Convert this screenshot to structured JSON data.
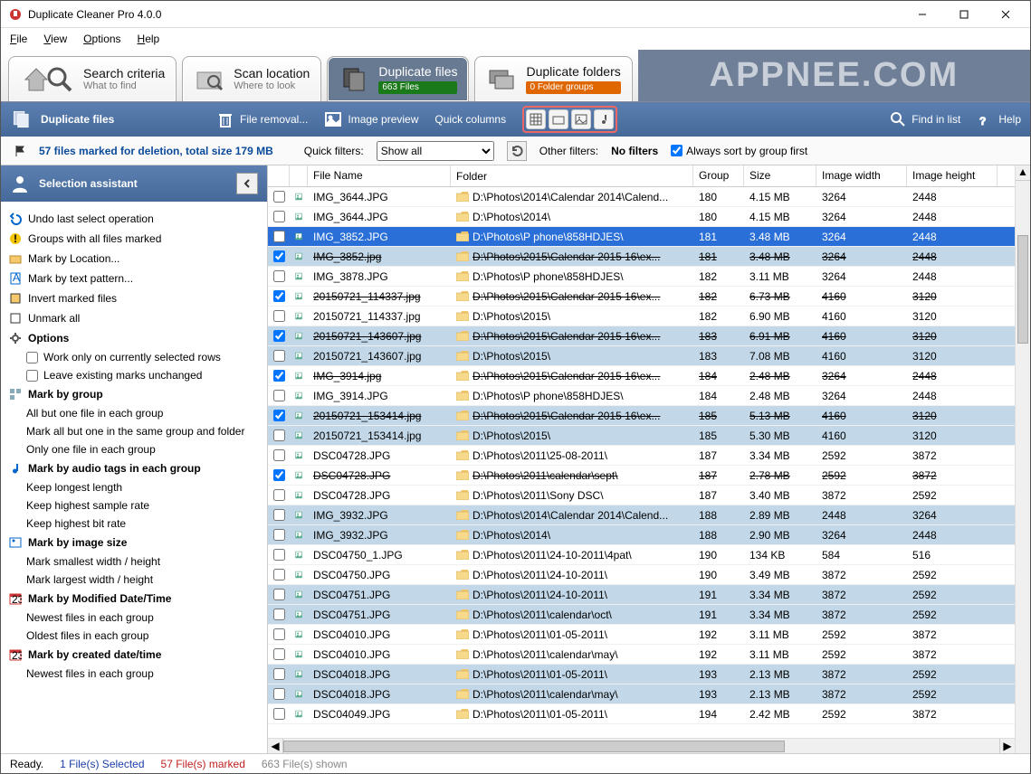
{
  "window": {
    "title": "Duplicate Cleaner Pro 4.0.0"
  },
  "menu": {
    "file": "File",
    "view": "View",
    "options": "Options",
    "help": "Help"
  },
  "tabs": {
    "search": {
      "title": "Search criteria",
      "sub": "What to find"
    },
    "scan": {
      "title": "Scan location",
      "sub": "Where to look"
    },
    "files": {
      "title": "Duplicate files",
      "badge": "663 Files"
    },
    "folders": {
      "title": "Duplicate folders",
      "badge": "0 Folder groups"
    }
  },
  "watermark": "APPNEE.COM",
  "bluebar": {
    "title": "Duplicate files",
    "removal": "File removal...",
    "preview": "Image preview",
    "quickcols": "Quick columns",
    "find": "Find in list",
    "help": "Help"
  },
  "filter": {
    "marked": "57 files marked for deletion, total size 179 MB",
    "quick_label": "Quick filters:",
    "showall": "Show all",
    "other_label": "Other filters:",
    "nofilters": "No filters",
    "sortfirst": "Always sort by group first"
  },
  "sidebar": {
    "title": "Selection assistant",
    "undo": "Undo last select operation",
    "groupsall": "Groups with all files marked",
    "byloc": "Mark by Location...",
    "bytext": "Mark by text pattern...",
    "invert": "Invert marked files",
    "unmark": "Unmark all",
    "options": "Options",
    "opt1": "Work only on currently selected rows",
    "opt2": "Leave existing marks unchanged",
    "bygroup": "Mark by group",
    "g1": "All but one file in each group",
    "g2": "Mark all but one in the same group and folder",
    "g3": "Only one file in each group",
    "byaudio": "Mark by audio tags in each group",
    "a1": "Keep longest length",
    "a2": "Keep highest sample rate",
    "a3": "Keep highest bit rate",
    "byimage": "Mark by image size",
    "i1": "Mark smallest width / height",
    "i2": "Mark largest width / height",
    "bymod": "Mark by Modified Date/Time",
    "m1": "Newest files in each group",
    "m2": "Oldest files in each group",
    "bycreated": "Mark by created date/time",
    "c1": "Newest files in each group"
  },
  "cols": {
    "name": "File Name",
    "folder": "Folder",
    "group": "Group",
    "size": "Size",
    "w": "Image width",
    "h": "Image height"
  },
  "rows": [
    {
      "chk": false,
      "strike": false,
      "sel": false,
      "blue": false,
      "name": "IMG_3644.JPG",
      "folder": "D:\\Photos\\2014\\Calendar 2014\\Calend...",
      "group": "180",
      "size": "4.15 MB",
      "w": "3264",
      "h": "2448"
    },
    {
      "chk": false,
      "strike": false,
      "sel": false,
      "blue": false,
      "name": "IMG_3644.JPG",
      "folder": "D:\\Photos\\2014\\",
      "group": "180",
      "size": "4.15 MB",
      "w": "3264",
      "h": "2448"
    },
    {
      "chk": false,
      "strike": false,
      "sel": true,
      "blue": true,
      "name": "IMG_3852.JPG",
      "folder": "D:\\Photos\\P phone\\858HDJES\\",
      "group": "181",
      "size": "3.48 MB",
      "w": "3264",
      "h": "2448"
    },
    {
      "chk": true,
      "strike": true,
      "sel": false,
      "blue": true,
      "name": "IMG_3852.jpg",
      "folder": "D:\\Photos\\2015\\Calendar 2015  16\\ex...",
      "group": "181",
      "size": "3.48 MB",
      "w": "3264",
      "h": "2448"
    },
    {
      "chk": false,
      "strike": false,
      "sel": false,
      "blue": false,
      "name": "IMG_3878.JPG",
      "folder": "D:\\Photos\\P phone\\858HDJES\\",
      "group": "182",
      "size": "3.11 MB",
      "w": "3264",
      "h": "2448"
    },
    {
      "chk": true,
      "strike": true,
      "sel": false,
      "blue": false,
      "name": "20150721_114337.jpg",
      "folder": "D:\\Photos\\2015\\Calendar 2015  16\\ex...",
      "group": "182",
      "size": "6.73 MB",
      "w": "4160",
      "h": "3120"
    },
    {
      "chk": false,
      "strike": false,
      "sel": false,
      "blue": false,
      "name": "20150721_114337.jpg",
      "folder": "D:\\Photos\\2015\\",
      "group": "182",
      "size": "6.90 MB",
      "w": "4160",
      "h": "3120"
    },
    {
      "chk": true,
      "strike": true,
      "sel": false,
      "blue": true,
      "name": "20150721_143607.jpg",
      "folder": "D:\\Photos\\2015\\Calendar 2015  16\\ex...",
      "group": "183",
      "size": "6.91 MB",
      "w": "4160",
      "h": "3120"
    },
    {
      "chk": false,
      "strike": false,
      "sel": false,
      "blue": true,
      "name": "20150721_143607.jpg",
      "folder": "D:\\Photos\\2015\\",
      "group": "183",
      "size": "7.08 MB",
      "w": "4160",
      "h": "3120"
    },
    {
      "chk": true,
      "strike": true,
      "sel": false,
      "blue": false,
      "name": "IMG_3914.jpg",
      "folder": "D:\\Photos\\2015\\Calendar 2015  16\\ex...",
      "group": "184",
      "size": "2.48 MB",
      "w": "3264",
      "h": "2448"
    },
    {
      "chk": false,
      "strike": false,
      "sel": false,
      "blue": false,
      "name": "IMG_3914.JPG",
      "folder": "D:\\Photos\\P phone\\858HDJES\\",
      "group": "184",
      "size": "2.48 MB",
      "w": "3264",
      "h": "2448"
    },
    {
      "chk": true,
      "strike": true,
      "sel": false,
      "blue": true,
      "name": "20150721_153414.jpg",
      "folder": "D:\\Photos\\2015\\Calendar 2015  16\\ex...",
      "group": "185",
      "size": "5.13 MB",
      "w": "4160",
      "h": "3120"
    },
    {
      "chk": false,
      "strike": false,
      "sel": false,
      "blue": true,
      "name": "20150721_153414.jpg",
      "folder": "D:\\Photos\\2015\\",
      "group": "185",
      "size": "5.30 MB",
      "w": "4160",
      "h": "3120"
    },
    {
      "chk": false,
      "strike": false,
      "sel": false,
      "blue": false,
      "name": "DSC04728.JPG",
      "folder": "D:\\Photos\\2011\\25-08-2011\\",
      "group": "187",
      "size": "3.34 MB",
      "w": "2592",
      "h": "3872"
    },
    {
      "chk": true,
      "strike": true,
      "sel": false,
      "blue": false,
      "name": "DSC04728.JPG",
      "folder": "D:\\Photos\\2011\\calendar\\sept\\",
      "group": "187",
      "size": "2.78 MB",
      "w": "2592",
      "h": "3872"
    },
    {
      "chk": false,
      "strike": false,
      "sel": false,
      "blue": false,
      "name": "DSC04728.JPG",
      "folder": "D:\\Photos\\2011\\Sony DSC\\",
      "group": "187",
      "size": "3.40 MB",
      "w": "3872",
      "h": "2592"
    },
    {
      "chk": false,
      "strike": false,
      "sel": false,
      "blue": true,
      "name": "IMG_3932.JPG",
      "folder": "D:\\Photos\\2014\\Calendar 2014\\Calend...",
      "group": "188",
      "size": "2.89 MB",
      "w": "2448",
      "h": "3264"
    },
    {
      "chk": false,
      "strike": false,
      "sel": false,
      "blue": true,
      "name": "IMG_3932.JPG",
      "folder": "D:\\Photos\\2014\\",
      "group": "188",
      "size": "2.90 MB",
      "w": "3264",
      "h": "2448"
    },
    {
      "chk": false,
      "strike": false,
      "sel": false,
      "blue": false,
      "name": "DSC04750_1.JPG",
      "folder": "D:\\Photos\\2011\\24-10-2011\\4pat\\",
      "group": "190",
      "size": "134 KB",
      "w": "584",
      "h": "516"
    },
    {
      "chk": false,
      "strike": false,
      "sel": false,
      "blue": false,
      "name": "DSC04750.JPG",
      "folder": "D:\\Photos\\2011\\24-10-2011\\",
      "group": "190",
      "size": "3.49 MB",
      "w": "3872",
      "h": "2592"
    },
    {
      "chk": false,
      "strike": false,
      "sel": false,
      "blue": true,
      "name": "DSC04751.JPG",
      "folder": "D:\\Photos\\2011\\24-10-2011\\",
      "group": "191",
      "size": "3.34 MB",
      "w": "3872",
      "h": "2592"
    },
    {
      "chk": false,
      "strike": false,
      "sel": false,
      "blue": true,
      "name": "DSC04751.JPG",
      "folder": "D:\\Photos\\2011\\calendar\\oct\\",
      "group": "191",
      "size": "3.34 MB",
      "w": "3872",
      "h": "2592"
    },
    {
      "chk": false,
      "strike": false,
      "sel": false,
      "blue": false,
      "name": "DSC04010.JPG",
      "folder": "D:\\Photos\\2011\\01-05-2011\\",
      "group": "192",
      "size": "3.11 MB",
      "w": "2592",
      "h": "3872"
    },
    {
      "chk": false,
      "strike": false,
      "sel": false,
      "blue": false,
      "name": "DSC04010.JPG",
      "folder": "D:\\Photos\\2011\\calendar\\may\\",
      "group": "192",
      "size": "3.11 MB",
      "w": "2592",
      "h": "3872"
    },
    {
      "chk": false,
      "strike": false,
      "sel": false,
      "blue": true,
      "name": "DSC04018.JPG",
      "folder": "D:\\Photos\\2011\\01-05-2011\\",
      "group": "193",
      "size": "2.13 MB",
      "w": "3872",
      "h": "2592"
    },
    {
      "chk": false,
      "strike": false,
      "sel": false,
      "blue": true,
      "name": "DSC04018.JPG",
      "folder": "D:\\Photos\\2011\\calendar\\may\\",
      "group": "193",
      "size": "2.13 MB",
      "w": "3872",
      "h": "2592"
    },
    {
      "chk": false,
      "strike": false,
      "sel": false,
      "blue": false,
      "name": "DSC04049.JPG",
      "folder": "D:\\Photos\\2011\\01-05-2011\\",
      "group": "194",
      "size": "2.42 MB",
      "w": "2592",
      "h": "3872"
    }
  ],
  "status": {
    "ready": "Ready.",
    "selected": "1 File(s) Selected",
    "marked": "57 File(s) marked",
    "shown": "663 File(s) shown"
  }
}
